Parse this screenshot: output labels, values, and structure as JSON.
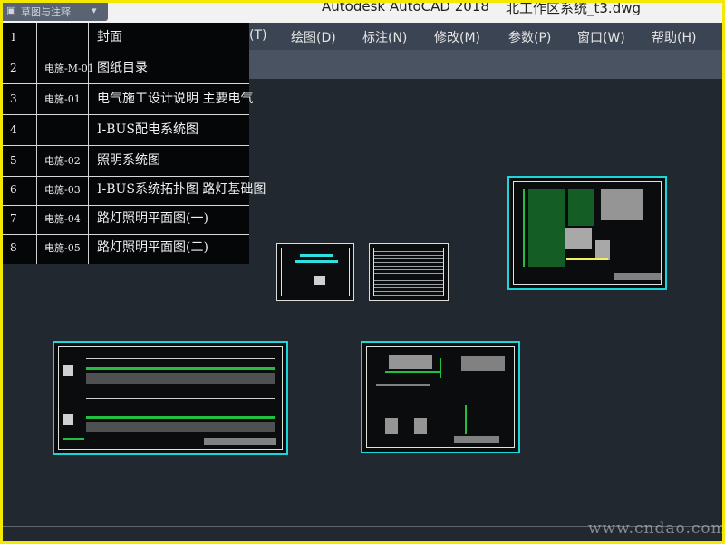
{
  "window": {
    "title": "Autodesk AutoCAD 2018",
    "filename": "北工作区系统_t3.dwg"
  },
  "quick_access": {
    "label": "草图与注释"
  },
  "menu": [
    {
      "label": "(T)"
    },
    {
      "label": "绘图(D)"
    },
    {
      "label": "标注(N)"
    },
    {
      "label": "修改(M)"
    },
    {
      "label": "参数(P)"
    },
    {
      "label": "窗口(W)"
    },
    {
      "label": "帮助(H)"
    }
  ],
  "drawing_table": {
    "rows": [
      {
        "num": "1",
        "code": "",
        "title": "封面"
      },
      {
        "num": "2",
        "code": "电施-M-01",
        "title": "图纸目录"
      },
      {
        "num": "3",
        "code": "电施-01",
        "title": "电气施工设计说明 主要电气"
      },
      {
        "num": "4",
        "code": "",
        "title": "I-BUS配电系统图"
      },
      {
        "num": "5",
        "code": "电施-02",
        "title": "照明系统图"
      },
      {
        "num": "6",
        "code": "电施-03",
        "title": "I-BUS系统拓扑图 路灯基础图"
      },
      {
        "num": "7",
        "code": "电施-04",
        "title": "路灯照明平面图(一)"
      },
      {
        "num": "8",
        "code": "电施-05",
        "title": "路灯照明平面图(二)"
      }
    ]
  },
  "watermark": "www.cndao.com",
  "colors": {
    "border": "#f5e800",
    "canvas": "#212830",
    "sheet_frame": "#1cd7d7",
    "linework": "#22c040"
  }
}
